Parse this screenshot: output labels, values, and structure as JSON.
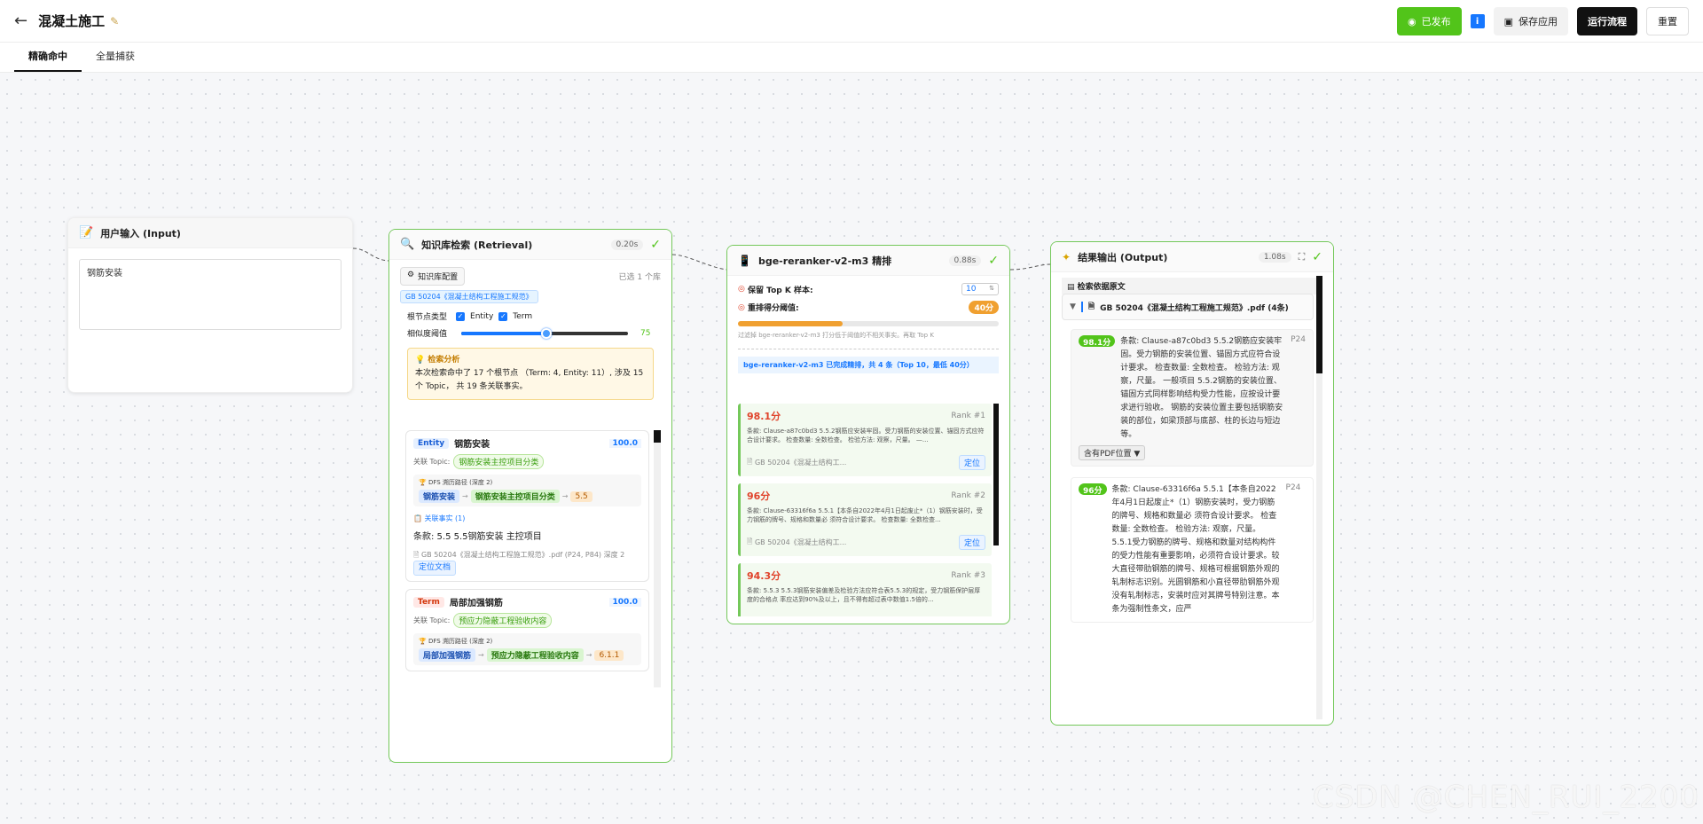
{
  "header": {
    "title": "混凝土施工",
    "publish_label": "已发布",
    "info_label": "i",
    "save_label": "保存应用",
    "run_label": "运行流程",
    "reset_label": "重置"
  },
  "tabs": [
    {
      "label": "精确命中",
      "active": true
    },
    {
      "label": "全量捕获",
      "active": false
    }
  ],
  "input_node": {
    "title": "用户输入 (Input)",
    "value": "钢筋安装"
  },
  "retrieval_node": {
    "title": "知识库检索 (Retrieval)",
    "time": "0.20s",
    "kb_button": "知识库配置",
    "selected_count": "已选 1 个库",
    "kb_tag": "GB 50204《混凝土结构工程施工规范》",
    "node_type_label": "根节点类型",
    "entity_label": "Entity",
    "term_label": "Term",
    "similarity_label": "相似度阈值",
    "similarity_value": 75,
    "analysis_title": "检索分析",
    "analysis_text": "本次检索命中了 17 个根节点 （Term: 4, Entity: 11）, 涉及 15 个 Topic， 共 19 条关联事实。",
    "results": [
      {
        "type": "Entity",
        "name": "钢筋安装",
        "score": "100.0",
        "topic_label": "关联 Topic:",
        "topic": "钢筋安装主控项目分类",
        "dfs_label": "DFS 溯历路径 (深度 2)",
        "path": [
          "钢筋安装",
          "钢筋安装主控项目分类",
          "5.5"
        ],
        "facts_label": "关联事实 (1)",
        "fact": "条款: 5.5 5.5钢筋安装 主控项目",
        "source": "GB 50204《混凝土结构工程施工规范》.pdf (P24, P84) 深度 2",
        "locate_label": "定位文档"
      },
      {
        "type": "Term",
        "name": "局部加强钢筋",
        "score": "100.0",
        "topic_label": "关联 Topic:",
        "topic": "预应力隐蔽工程验收内容",
        "dfs_label": "DFS 溯历路径 (深度 2)",
        "path": [
          "局部加强钢筋",
          "预应力隐蔽工程验收内容",
          "6.1.1"
        ]
      }
    ]
  },
  "rerank_node": {
    "title": "bge-reranker-v2-m3 精排",
    "time": "0.88s",
    "topk_label": "保留 Top K 样本:",
    "topk_value": "10",
    "threshold_label": "重排得分阈值:",
    "threshold_value": "40分",
    "threshold_fraction": 0.4,
    "hint": "过滤掉 bge-reranker-v2-m3 打分低于阈值的不相关事实。再取 Top K",
    "summary": "bge-reranker-v2-m3 已完成精排，共 4 条（Top 10，最低 40分）",
    "items": [
      {
        "score": "98.1分",
        "rank": "Rank #1",
        "text": "条款: Clause-a87c0bd3 5.5.2钢筋应安装牢固。受力钢筋的安装位置、锚固方式应符合设计要求。 检查数量: 全数检查。 检验方法: 观察，尺量。 —...",
        "source": "GB 50204《混凝土结构工...",
        "locate": "定位"
      },
      {
        "score": "96分",
        "rank": "Rank #2",
        "text": "条款: Clause-63316f6a 5.5.1【本条自2022年4月1日起废止*（1）钢筋安装时，受力钢筋的牌号、规格和数量必 须符合设计要求。 检查数量: 全数检查...",
        "source": "GB 50204《混凝土结构工...",
        "locate": "定位"
      },
      {
        "score": "94.3分",
        "rank": "Rank #3",
        "text": "条款: 5.5.3 5.5.3钢筋安装偏差及检验方法应符合表5.5.3的规定，受力钢筋保护层厚度的合格点 率应达到90%及以上，且不得有超过表中数值1.5倍的...",
        "source": "",
        "locate": ""
      }
    ]
  },
  "output_node": {
    "title": "结果输出 (Output)",
    "time": "1.08s",
    "section_label": "检索依据原文",
    "doc_title": "GB 50204《混凝土结构工程施工规范》.pdf (4条)",
    "items": [
      {
        "score": "98.1分",
        "page": "P24",
        "text": "条款: Clause-a87c0bd3 5.5.2钢筋应安装牢固。受力钢筋的安装位置、锚固方式应符合设计要求。 检查数量: 全数检查。 检验方法: 观察，尺量。 一般项目 5.5.2钢筋的安装位置、锚固方式同样影响结构受力性能，应按设计要求进行验收。 钢筋的安装位置主要包括钢筋安装的部位，如梁顶部与底部、柱的长边与短边等。",
        "locate": "含有PDF位置 ▼"
      },
      {
        "score": "96分",
        "page": "P24",
        "text": "条款: Clause-63316f6a 5.5.1【本条自2022年4月1日起废止*（1）钢筋安装时，受力钢筋的牌号、规格和数量必 须符合设计要求。 检查数量: 全数检查。 检验方法: 观察，尺量。 5.5.1受力钢筋的牌号、规格和数量对结构构件的受力性能有重要影响，必须符合设计要求。较大直径带肋钢筋的牌号、规格可根据钢筋外观的轧制标志识别。光圆钢筋和小直径带肋钢筋外观没有轧制标志，安装时应对其牌号特别注意。本条为强制性条文，应严"
      }
    ]
  },
  "watermark": "CSDN @CHEN_RUI_2200",
  "colors": {
    "accent_green": "#52c41a",
    "node_border": "#74c85a",
    "brand_blue": "#1677ff",
    "score_red": "#e0432b",
    "threshold_orange": "#f0a030"
  }
}
